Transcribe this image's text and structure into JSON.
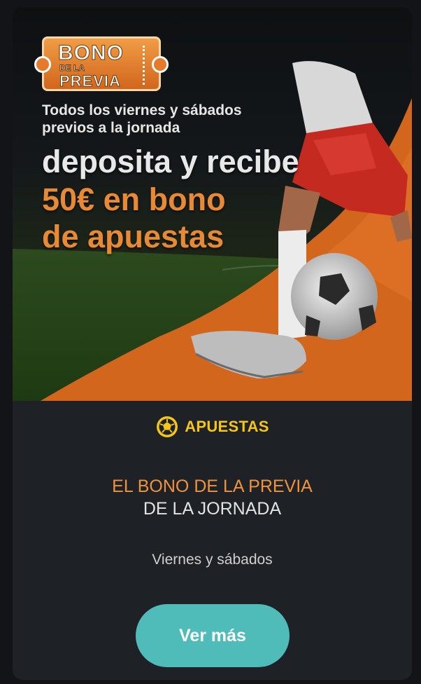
{
  "banner": {
    "logo": {
      "line1": "BONO",
      "line2": "DE LA",
      "line3": "PREVIA"
    },
    "subtitle": "Todos los viernes y sábados previos a la jornada",
    "headline": "deposita y recibe",
    "offer_line1": "50€ en bono",
    "offer_line2": "de apuestas"
  },
  "category": {
    "icon": "football-icon",
    "label": "APUESTAS"
  },
  "promo": {
    "title_line1": "EL BONO DE LA PREVIA",
    "title_line2": "DE LA JORNADA",
    "schedule": "Viernes y sábados"
  },
  "cta": {
    "label": "Ver más"
  },
  "colors": {
    "accent_orange": "#f0933a",
    "category_yellow": "#f5c518",
    "button_teal": "#4fbcb9",
    "card_bg": "#1e2126"
  }
}
